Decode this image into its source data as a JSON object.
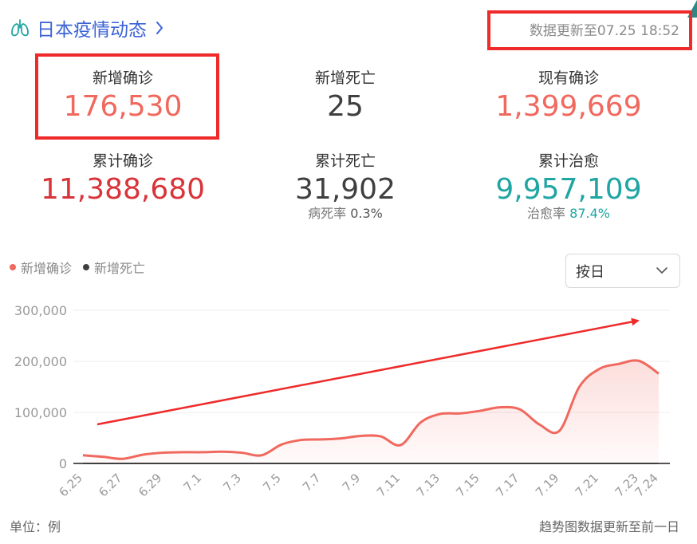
{
  "header": {
    "title": "日本疫情动态",
    "update": "数据更新至07.25 18:52"
  },
  "stats": {
    "new_confirmed": {
      "label": "新增确诊",
      "value": "176,530"
    },
    "new_deaths": {
      "label": "新增死亡",
      "value": "25"
    },
    "current_confirmed": {
      "label": "现有确诊",
      "value": "1,399,669"
    },
    "total_confirmed": {
      "label": "累计确诊",
      "value": "11,388,680"
    },
    "total_deaths": {
      "label": "累计死亡",
      "value": "31,902",
      "rate_label": "病死率",
      "rate": "0.3%"
    },
    "total_cured": {
      "label": "累计治愈",
      "value": "9,957,109",
      "rate_label": "治愈率",
      "rate": "87.4%"
    }
  },
  "colors": {
    "confirmed": "#f0685e",
    "deaths": "#3f3f3f",
    "cured": "#1fa5a3",
    "accent": "#3b63d6",
    "highlight": "#ee2a2a"
  },
  "select": {
    "value": "按日"
  },
  "footer": {
    "unit": "单位：例",
    "note": "趋势图数据更新至前一日"
  },
  "chart_data": {
    "type": "area",
    "x": [
      "6.25",
      "6.26",
      "6.27",
      "6.28",
      "6.29",
      "6.30",
      "7.1",
      "7.2",
      "7.3",
      "7.4",
      "7.5",
      "7.6",
      "7.7",
      "7.8",
      "7.9",
      "7.10",
      "7.11",
      "7.12",
      "7.13",
      "7.14",
      "7.15",
      "7.16",
      "7.17",
      "7.18",
      "7.19",
      "7.20",
      "7.21",
      "7.22",
      "7.23",
      "7.24"
    ],
    "x_tick_labels": [
      "6.25",
      "6.27",
      "6.29",
      "7.1",
      "7.3",
      "7.5",
      "7.7",
      "7.9",
      "7.11",
      "7.13",
      "7.15",
      "7.17",
      "7.19",
      "7.21",
      "7.23",
      "7.24"
    ],
    "series": [
      {
        "name": "新增确诊",
        "color": "#f0685e",
        "values": [
          16000,
          13000,
          9000,
          17000,
          21000,
          22000,
          22000,
          23000,
          21000,
          16000,
          37000,
          46000,
          47000,
          49000,
          54000,
          53000,
          36000,
          80000,
          97000,
          98000,
          103000,
          110000,
          106000,
          76000,
          64000,
          150000,
          185000,
          195000,
          201000,
          176000
        ]
      },
      {
        "name": "新增死亡",
        "color": "#3f3f3f",
        "values": [
          12,
          10,
          9,
          11,
          12,
          13,
          14,
          12,
          11,
          10,
          13,
          15,
          16,
          14,
          13,
          12,
          11,
          16,
          18,
          19,
          20,
          22,
          21,
          18,
          17,
          22,
          24,
          26,
          27,
          25
        ]
      }
    ],
    "yticks": [
      0,
      100000,
      200000,
      300000
    ],
    "ytick_labels": [
      "0",
      "100,000",
      "200,000",
      "300,000"
    ],
    "ylim": [
      0,
      300000
    ],
    "legend": "top-left",
    "grid": true,
    "annotation": "red trend arrow pointing up-right"
  }
}
